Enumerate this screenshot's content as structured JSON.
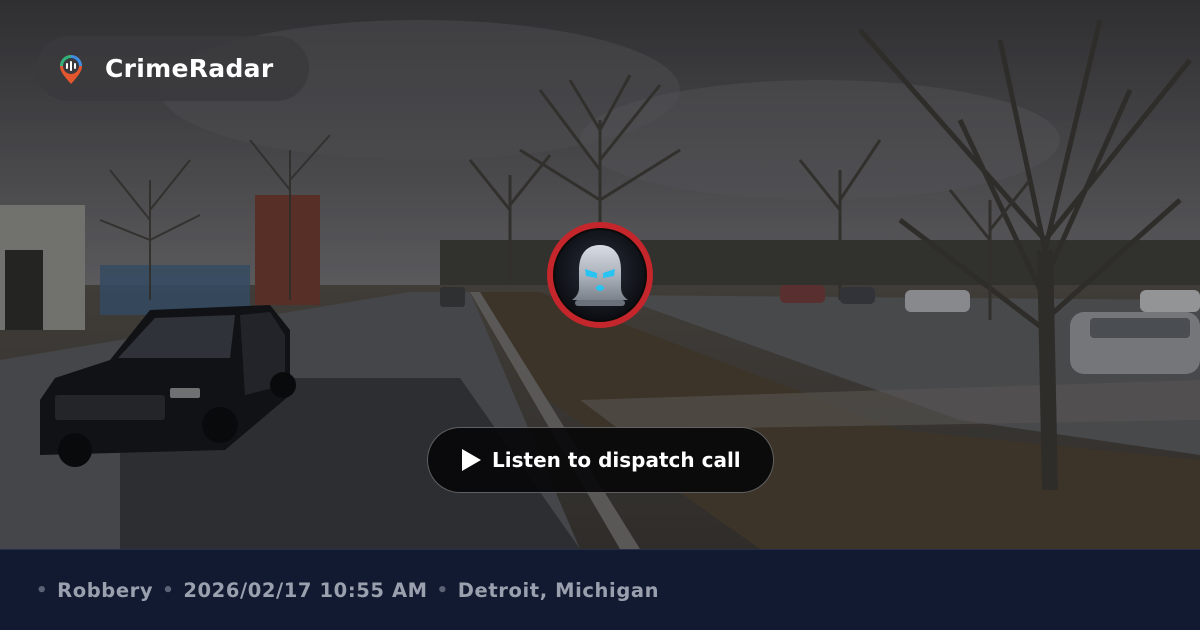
{
  "brand": {
    "name": "CrimeRadar",
    "logo_icon": "radar-pin-icon",
    "logo_colors": [
      "#2fb37a",
      "#e4572e",
      "#f2b134",
      "#3a8ee6"
    ]
  },
  "incident": {
    "avatar_icon": "masked-robber-icon",
    "avatar_ring_color": "#c4262b",
    "avatar_eye_color": "#27c3f2"
  },
  "actions": {
    "play_label": "Listen to dispatch call",
    "play_icon": "play-icon"
  },
  "meta": {
    "category": "Robbery",
    "datetime": "2026/02/17 10:55 AM",
    "location": "Detroit, Michigan",
    "separator": "•"
  },
  "colors": {
    "footer_bg": "#111a30",
    "footer_text": "#9aa0ae"
  }
}
